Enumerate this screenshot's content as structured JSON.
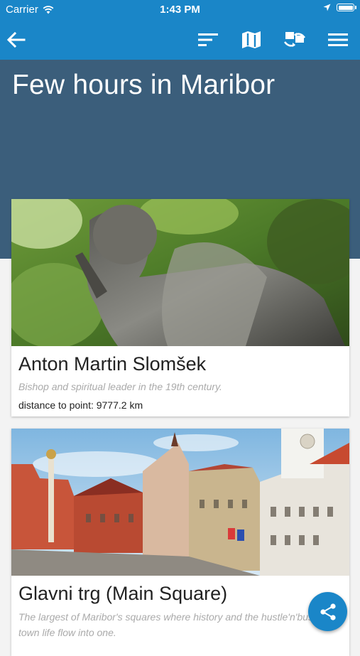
{
  "status_bar": {
    "carrier": "Carrier",
    "time": "1:43 PM"
  },
  "toolbar": {
    "back_icon": "arrow-left-icon",
    "sort_icon": "sort-icon",
    "map_icon": "map-icon",
    "transfer_icon": "transfer-icon",
    "menu_icon": "menu-icon"
  },
  "page": {
    "title": "Few hours in Maribor"
  },
  "points": [
    {
      "title": "Anton Martin Slomšek",
      "description": "Bishop and spiritual leader in the 19th century.",
      "distance": "distance to point: 9777.2 km"
    },
    {
      "title": "Glavni trg (Main Square)",
      "description": "The largest of Maribor's squares where history and the hustle'n'bustle of town life flow into one."
    }
  ],
  "fab": {
    "icon": "share-icon"
  },
  "colors": {
    "primary": "#1a86c8",
    "header_band": "#3b5e7b"
  }
}
